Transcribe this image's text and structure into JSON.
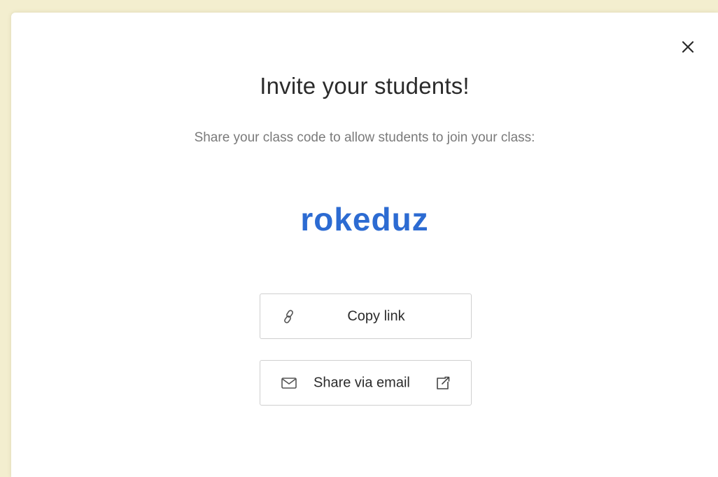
{
  "modal": {
    "title": "Invite your students!",
    "subtitle": "Share your class code to allow students to join your class:",
    "class_code": "rokeduz",
    "copy_link_label": "Copy link",
    "share_email_label": "Share via email",
    "icons": {
      "close": "close-icon",
      "copy": "link-icon",
      "email": "mail-icon",
      "external": "external-link-icon"
    },
    "colors": {
      "class_code": "#2c6bd2",
      "backdrop": "#f3eecf"
    }
  }
}
